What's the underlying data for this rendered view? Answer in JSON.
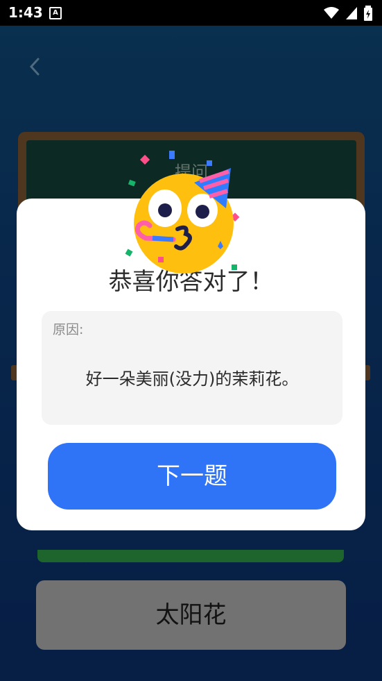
{
  "status_bar": {
    "time": "1:43",
    "notification_icon": "font-a-icon",
    "icons": [
      "wifi-icon",
      "signal-icon",
      "battery-charging-icon"
    ]
  },
  "nav": {
    "back_icon": "chevron-left-icon"
  },
  "board": {
    "title": "提问"
  },
  "option": {
    "label": "太阳花"
  },
  "dialog": {
    "emoji_icon": "party-face-icon",
    "title": "恭喜你答对了！",
    "reason_label": "原因:",
    "reason_text": "好一朵美丽(没力)的茉莉花。",
    "next_button": "下一题"
  },
  "colors": {
    "primary_button": "#2f73f6",
    "board_frame": "#7a5330",
    "board_surface": "#153f36",
    "background": "#0d3b73"
  }
}
